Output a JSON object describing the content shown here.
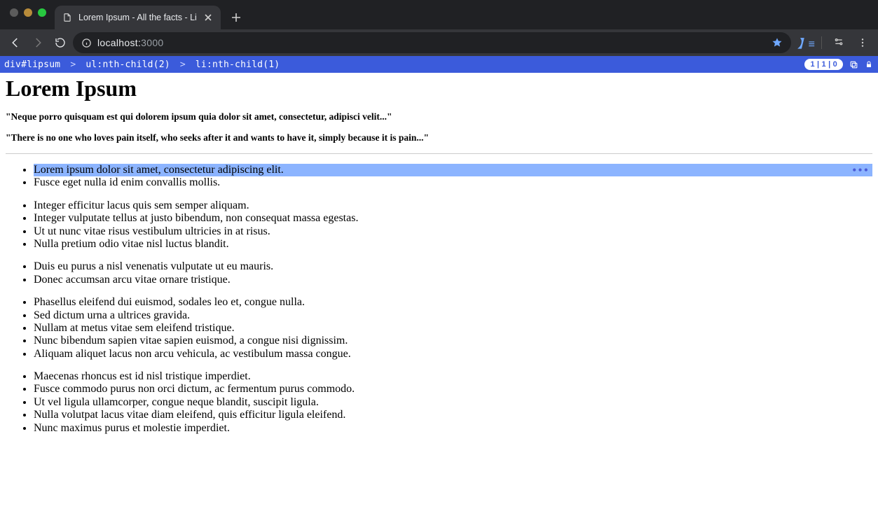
{
  "browser": {
    "tab_title": "Lorem Ipsum - All the facts - Li",
    "url_host": "localhost:",
    "url_port": "3000"
  },
  "devtools": {
    "crumb1": "div#lipsum",
    "crumb2": "ul:nth-child(2)",
    "crumb3": "li:nth-child(1)",
    "badge": "1 | 1 | 0"
  },
  "content": {
    "h1": "Lorem Ipsum",
    "sub1": "\"Neque porro quisquam est qui dolorem ipsum quia dolor sit amet, consectetur, adipisci velit...\"",
    "sub2": "\"There is no one who loves pain itself, who seeks after it and wants to have it, simply because it is pain...\"",
    "lists": [
      [
        "Lorem ipsum dolor sit amet, consectetur adipiscing elit.",
        "Fusce eget nulla id enim convallis mollis."
      ],
      [
        "Integer efficitur lacus quis sem semper aliquam.",
        "Integer vulputate tellus at justo bibendum, non consequat massa egestas.",
        "Ut ut nunc vitae risus vestibulum ultricies in at risus.",
        "Nulla pretium odio vitae nisl luctus blandit."
      ],
      [
        "Duis eu purus a nisl venenatis vulputate ut eu mauris.",
        "Donec accumsan arcu vitae ornare tristique."
      ],
      [
        "Phasellus eleifend dui euismod, sodales leo et, congue nulla.",
        "Sed dictum urna a ultrices gravida.",
        "Nullam at metus vitae sem eleifend tristique.",
        "Nunc bibendum sapien vitae sapien euismod, a congue nisi dignissim.",
        "Aliquam aliquet lacus non arcu vehicula, ac vestibulum massa congue."
      ],
      [
        "Maecenas rhoncus est id nisl tristique imperdiet.",
        "Fusce commodo purus non orci dictum, ac fermentum purus commodo.",
        "Ut vel ligula ullamcorper, congue neque blandit, suscipit ligula.",
        "Nulla volutpat lacus vitae diam eleifend, quis efficitur ligula eleifend.",
        "Nunc maximus purus et molestie imperdiet."
      ]
    ]
  }
}
